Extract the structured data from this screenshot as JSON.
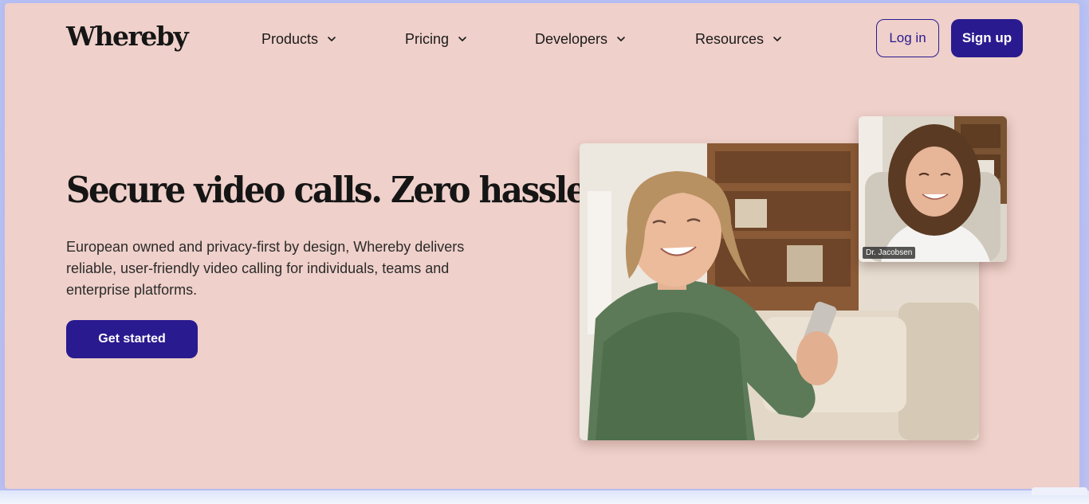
{
  "brand": {
    "logo_text": "Whereby"
  },
  "nav": {
    "items": [
      {
        "label": "Products"
      },
      {
        "label": "Pricing"
      },
      {
        "label": "Developers"
      },
      {
        "label": "Resources"
      }
    ],
    "login_label": "Log in",
    "signup_label": "Sign up"
  },
  "hero": {
    "title": "Secure video calls. Zero hassle",
    "description": "European owned and privacy-first by design, Whereby delivers reliable, user-friendly video calling for individuals, teams and enterprise platforms.",
    "cta_label": "Get started"
  },
  "video": {
    "pip_name": "Dr. Jacobsen"
  },
  "icons": {
    "nav_chevron": "chevron-down-icon"
  },
  "colors": {
    "page_background": "#efd0ca",
    "primary": "#2a1a8f",
    "text": "#151515"
  }
}
